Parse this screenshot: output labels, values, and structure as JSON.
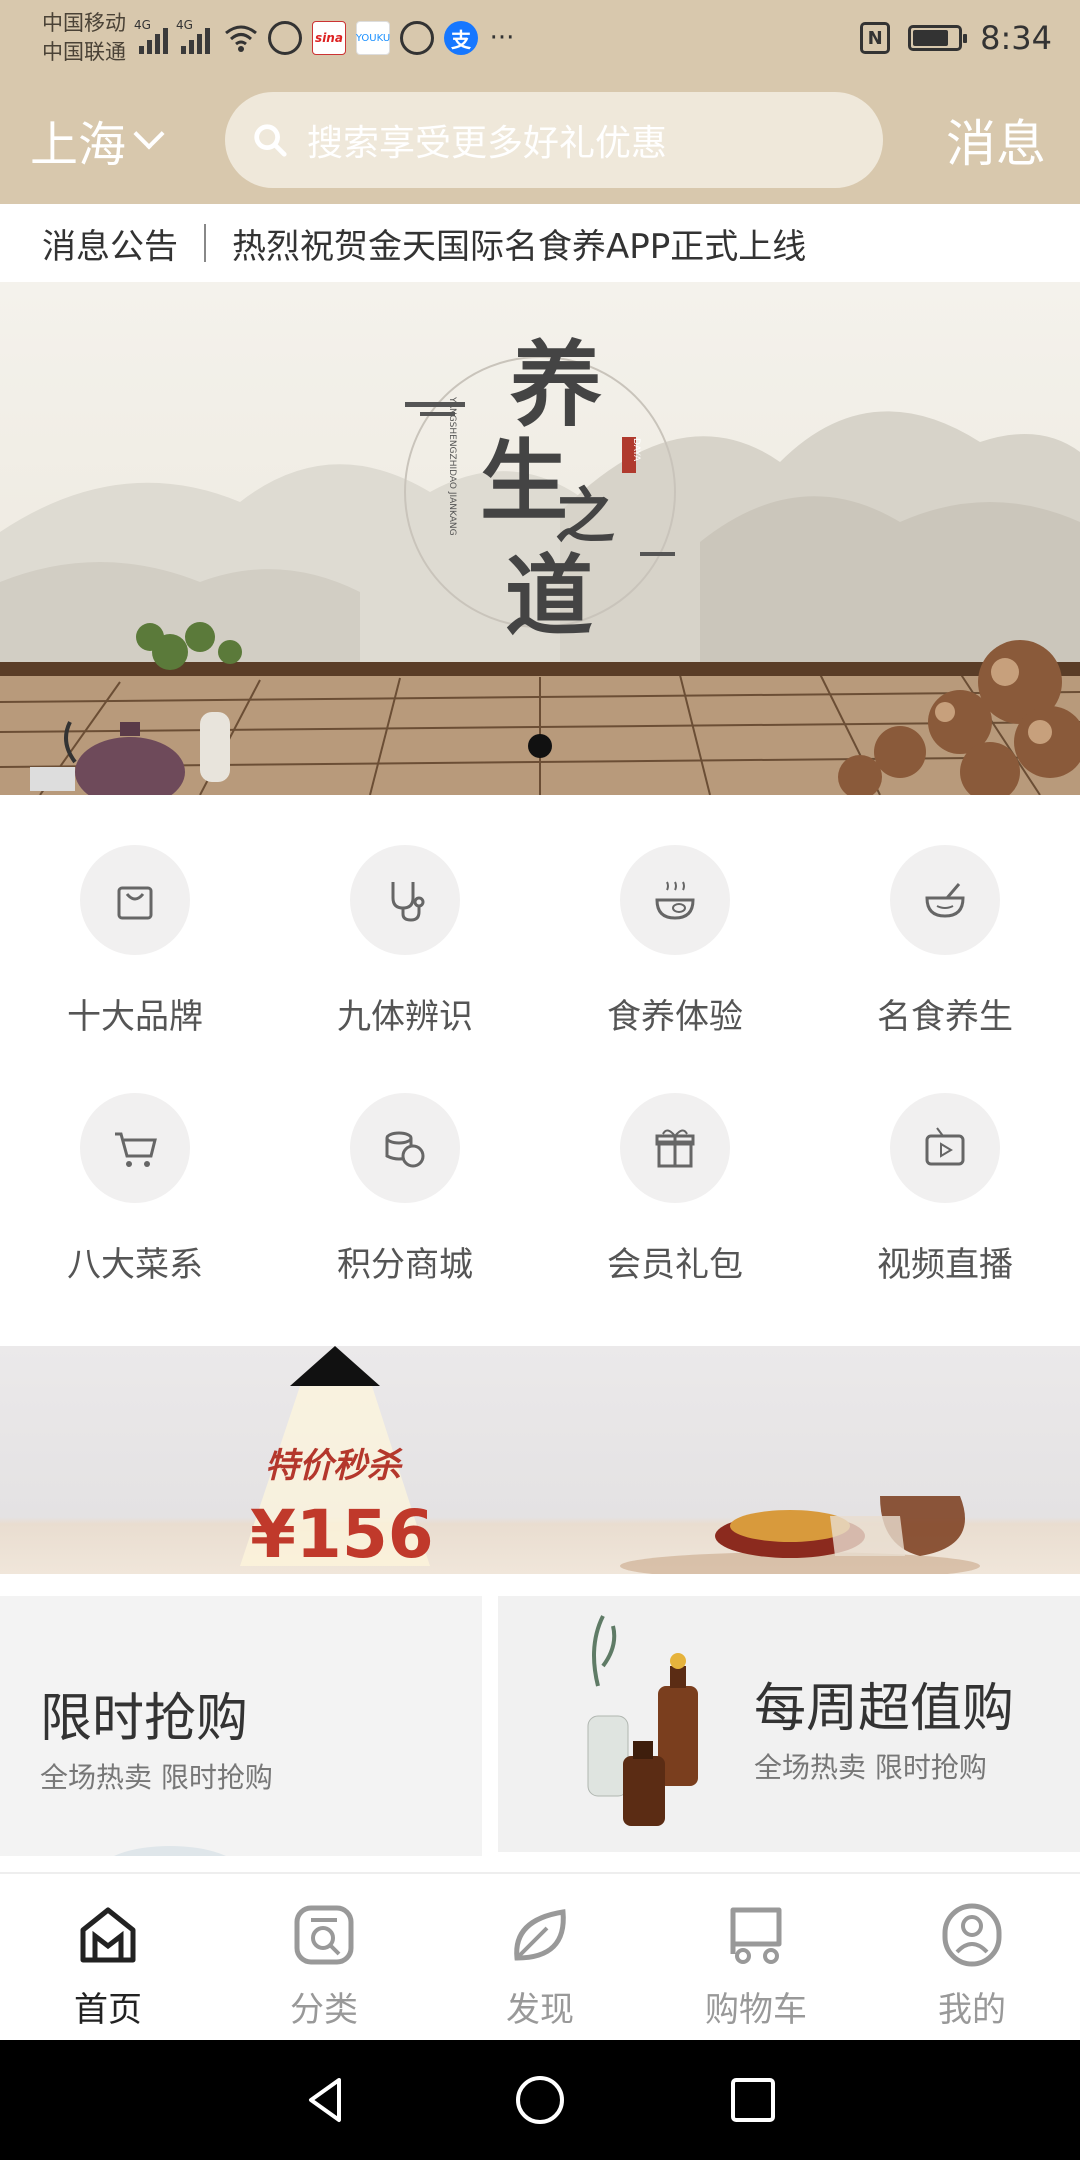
{
  "status_bar": {
    "carrier1": "中国移动",
    "carrier2": "中国联通",
    "net1": "4G",
    "net2": "4G",
    "sina": "sina",
    "youku": "YOUKU",
    "alipay": "支",
    "more": "···",
    "nfc": "N",
    "time": "8:34"
  },
  "header": {
    "city": "上海",
    "search_placeholder": "搜索享受更多好礼优惠",
    "message_label": "消息"
  },
  "notice": {
    "label": "消息公告",
    "text": "热烈祝贺金天国际名食养APP正式上线"
  },
  "banner": {
    "calligraphy": [
      "养",
      "生",
      "之",
      "道"
    ],
    "seal": "DAYA",
    "latin": "YANGSHENGZHIDAO JIANKANG",
    "slide_count": 1,
    "active_slide": 1
  },
  "categories": [
    {
      "label": "十大品牌",
      "icon": "shopping-bag-icon"
    },
    {
      "label": "九体辨识",
      "icon": "stethoscope-icon"
    },
    {
      "label": "食养体验",
      "icon": "bowl-icon"
    },
    {
      "label": "名食养生",
      "icon": "mortar-icon"
    },
    {
      "label": "八大菜系",
      "icon": "cart-icon"
    },
    {
      "label": "积分商城",
      "icon": "coins-icon"
    },
    {
      "label": "会员礼包",
      "icon": "gift-icon"
    },
    {
      "label": "视频直播",
      "icon": "tv-play-icon"
    }
  ],
  "promo": {
    "title": "特价秒杀",
    "price": "¥156"
  },
  "cards": {
    "left": {
      "title": "限时抢购",
      "subtitle": "全场热卖 限时抢购"
    },
    "right": {
      "title": "每周超值购",
      "subtitle": "全场热卖 限时抢购"
    }
  },
  "tabs": [
    {
      "label": "首页",
      "icon": "home-icon",
      "active": true
    },
    {
      "label": "分类",
      "icon": "category-icon",
      "active": false
    },
    {
      "label": "发现",
      "icon": "leaf-icon",
      "active": false
    },
    {
      "label": "购物车",
      "icon": "cart-icon",
      "active": false
    },
    {
      "label": "我的",
      "icon": "profile-icon",
      "active": false
    }
  ],
  "colors": {
    "header_bg": "#d8c8ad",
    "price_red": "#c0392b",
    "tab_active": "#222222",
    "tab_inactive": "#999999"
  }
}
